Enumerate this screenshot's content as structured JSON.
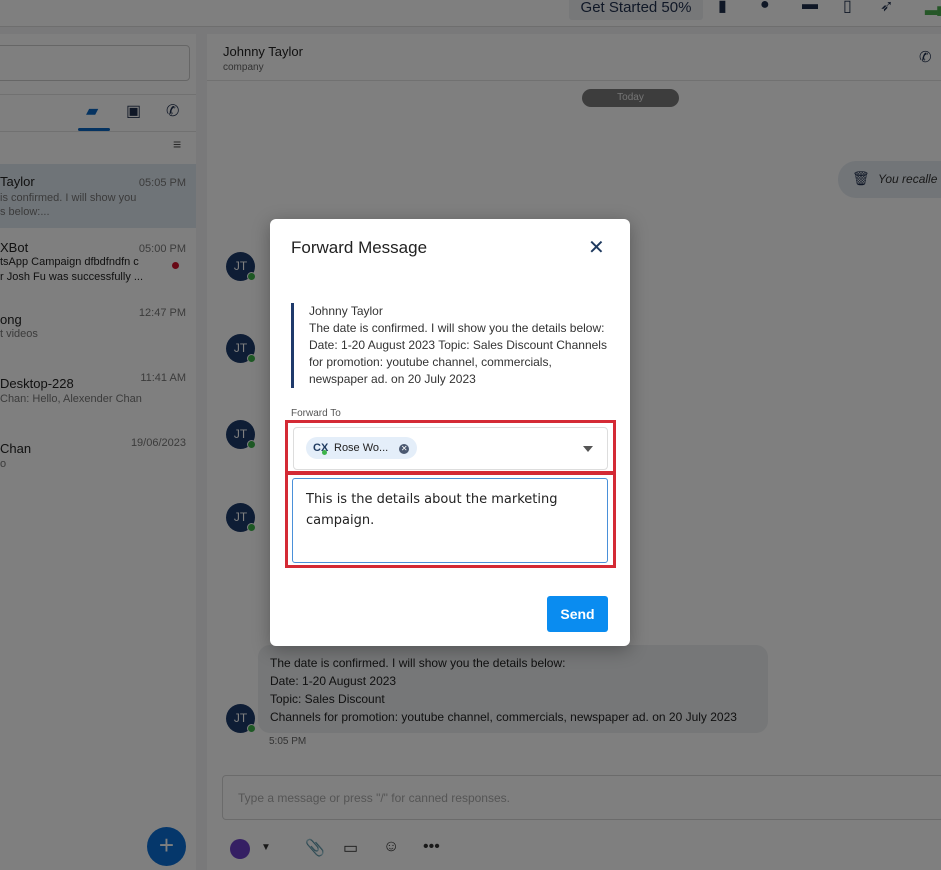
{
  "topbar": {
    "get_started": "Get Started 50%"
  },
  "conversations": [
    {
      "name": "Taylor",
      "time": "05:05 PM",
      "preview": [
        "is confirmed. I will show you",
        "s below:..."
      ],
      "selected": true
    },
    {
      "name": "XBot",
      "time": "05:00 PM",
      "preview": [
        "tsApp Campaign dfbdfndfn c",
        "r Josh Fu was successfully ..."
      ],
      "unread": true
    },
    {
      "name": "ong",
      "time": "12:47 PM",
      "preview": [
        "t videos"
      ]
    },
    {
      "name": "Desktop-228",
      "time": "11:41 AM",
      "preview": [
        "Chan: Hello, Alexender Chan"
      ]
    },
    {
      "name": "Chan",
      "time": "19/06/2023",
      "preview": [
        "o"
      ]
    }
  ],
  "chat": {
    "name": "Johnny Taylor",
    "subtitle": "company",
    "date_divider": "Today",
    "recalled": "You recalle",
    "avatar_initials": "JT",
    "last_message": [
      "The date is confirmed. I will show you the details below:",
      "Date: 1-20 August 2023",
      "Topic: Sales Discount",
      "Channels for promotion: youtube channel, commercials, newspaper ad. on 20 July 2023"
    ],
    "last_time": "5:05 PM",
    "composer_placeholder": "Type a message or press \"/\" for canned responses."
  },
  "modal": {
    "title": "Forward Message",
    "quote_author": "Johnny Taylor",
    "quote_text": "The date is confirmed. I will show you the details below: Date: 1-20 August 2023 Topic: Sales Discount Channels for promotion: youtube channel, commercials, newspaper ad. on 20 July 2023",
    "forward_to_label": "Forward To",
    "recipient": "Rose Wo...",
    "message": "This is the details about the marketing campaign.",
    "send": "Send"
  },
  "colors": {
    "accent": "#0a8cf0",
    "highlight": "#d42a35",
    "avatar": "#1c3a6b"
  }
}
